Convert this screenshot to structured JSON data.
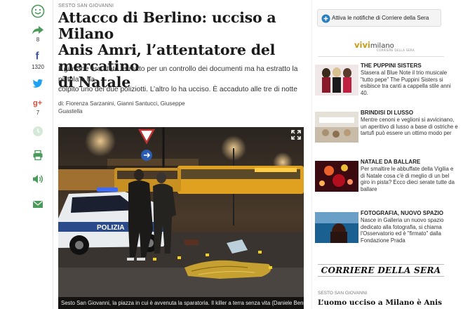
{
  "share": {
    "facebook_count": "1320",
    "googleplus_count": "7",
    "share_count": "8",
    "icons": [
      "smiley-icon",
      "share-arrow-icon",
      "facebook-icon",
      "twitter-icon",
      "googleplus-icon",
      "clock-icon",
      "print-icon",
      "audio-icon",
      "email-icon"
    ]
  },
  "article": {
    "kicker": "SESTO SAN GIOVANNI",
    "headline_lines": [
      "Attacco di Berlino: ucciso a Milano",
      "Anis Amri, l’attentatore del mercatino",
      "di Natale"
    ],
    "summary_lines": [
      "Il giovane era stato fermato per un controllo dei documenti ma ha estratto la pistola e ha",
      "colpito uno dei due poliziotti. L’altro lo ha ucciso. È accaduto alle tre di notte"
    ],
    "authors_lines": [
      "di: Fiorenza Sarzanini, Gianni Santucci, Giuseppe",
      "Guastella"
    ],
    "photo_caption": "Sesto San Giovanni, la piazza in cui è avvenuta la sparatoria. Il killer a terra senza vita (Daniele Bennati)"
  },
  "sidebar": {
    "notify_label": "Attiva le notifiche di Corriere della Sera",
    "vivimilano_brand": "vivi",
    "vivimilano_city": "milano",
    "vivimilano_sub": "CORRIERE DELLA SERA",
    "items": [
      {
        "title": "THE PUPPINI SISTERS",
        "desc": "Stasera al Blue Note il trio musicale \"tutto pepe\" The Puppini Sisters si esibisce tra canti a cappella stile anni 40."
      },
      {
        "title": "BRINDISI DI LUSSO",
        "desc": "Mentre cenoni e veglioni si avvicinano, un aperitivo di lusso a base di ostriche e tartufi può essere un ottimo modo per"
      },
      {
        "title": "NATALE DA BALLARE",
        "desc": "Per smaltire le abbuffate della Vigilia e di Natale cosa c'è di meglio di un bel giro in pista? Ecco dieci serate tutte da ballare"
      },
      {
        "title": "FOTOGRAFIA, NUOVO SPAZIO",
        "desc": "Nasce in Galleria un nuovo spazio dedicato alla fotografia, si chiama l'Osservatorio ed è \"firmato\" dalla Fondazione Prada"
      }
    ],
    "cds_logo": "CORRIERE DELLA SERA",
    "cds_kicker": "SESTO SAN GIOVANNI",
    "cds_headline": "L’uomo ucciso a Milano è Anis"
  },
  "colors": {
    "accent_blue": "#2a7fc1",
    "facebook": "#3b5998",
    "twitter": "#1da1f2",
    "googleplus": "#dd4b39",
    "icon_green": "#4a9a5a"
  }
}
